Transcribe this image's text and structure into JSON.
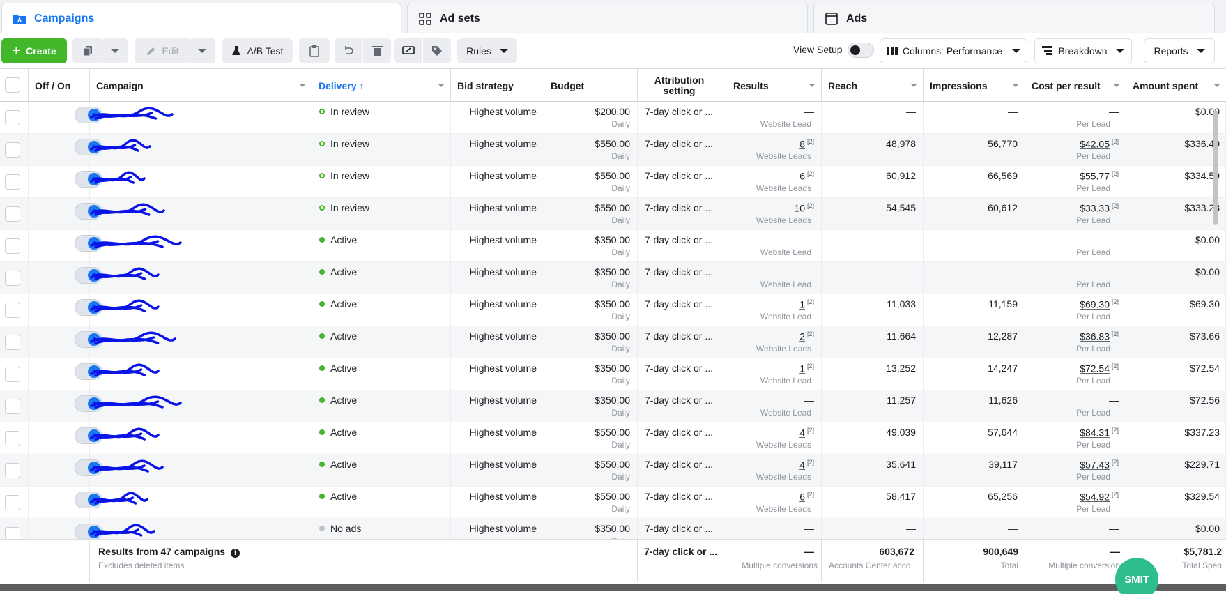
{
  "tabs": [
    {
      "label": "Campaigns",
      "icon": "folder-icon",
      "active": true
    },
    {
      "label": "Ad sets",
      "icon": "grid-icon",
      "active": false
    },
    {
      "label": "Ads",
      "icon": "ad-icon",
      "active": false
    }
  ],
  "toolbar": {
    "create_label": "Create",
    "edit_label": "Edit",
    "ab_test_label": "A/B Test",
    "rules_label": "Rules",
    "view_setup_label": "View Setup",
    "columns_label": "Columns: Performance",
    "breakdown_label": "Breakdown",
    "reports_label": "Reports"
  },
  "columns": {
    "off_on": "Off / On",
    "campaign": "Campaign",
    "delivery": "Delivery",
    "bid_strategy": "Bid strategy",
    "budget": "Budget",
    "attribution": "Attribution setting",
    "results": "Results",
    "reach": "Reach",
    "impressions": "Impressions",
    "cost_per_result": "Cost per result",
    "amount_spent": "Amount spent"
  },
  "rows": [
    {
      "delivery": "In review",
      "status": "review",
      "bid": "Highest volume",
      "budget": "$200.00",
      "budget_type": "Daily",
      "attribution": "7-day click or ...",
      "results": "—",
      "results_sub": "Website Lead",
      "reach": "—",
      "impressions": "—",
      "cpr": "—",
      "cpr_sub": "Per Lead",
      "spent": "$0.00"
    },
    {
      "delivery": "In review",
      "status": "review",
      "bid": "Highest volume",
      "budget": "$550.00",
      "budget_type": "Daily",
      "attribution": "7-day click or ...",
      "results": "8",
      "results_sub": "Website Leads",
      "reach": "48,978",
      "impressions": "56,770",
      "cpr": "$42.05",
      "cpr_sub": "Per Lead",
      "spent": "$336.40"
    },
    {
      "delivery": "In review",
      "status": "review",
      "bid": "Highest volume",
      "budget": "$550.00",
      "budget_type": "Daily",
      "attribution": "7-day click or ...",
      "results": "6",
      "results_sub": "Website Leads",
      "reach": "60,912",
      "impressions": "66,569",
      "cpr": "$55.77",
      "cpr_sub": "Per Lead",
      "spent": "$334.59"
    },
    {
      "delivery": "In review",
      "status": "review",
      "bid": "Highest volume",
      "budget": "$550.00",
      "budget_type": "Daily",
      "attribution": "7-day click or ...",
      "results": "10",
      "results_sub": "Website Leads",
      "reach": "54,545",
      "impressions": "60,612",
      "cpr": "$33.33",
      "cpr_sub": "Per Lead",
      "spent": "$333.28"
    },
    {
      "delivery": "Active",
      "status": "active",
      "bid": "Highest volume",
      "budget": "$350.00",
      "budget_type": "Daily",
      "attribution": "7-day click or ...",
      "results": "—",
      "results_sub": "Website Lead",
      "reach": "—",
      "impressions": "—",
      "cpr": "—",
      "cpr_sub": "Per Lead",
      "spent": "$0.00"
    },
    {
      "delivery": "Active",
      "status": "active",
      "bid": "Highest volume",
      "budget": "$350.00",
      "budget_type": "Daily",
      "attribution": "7-day click or ...",
      "results": "—",
      "results_sub": "Website Lead",
      "reach": "—",
      "impressions": "—",
      "cpr": "—",
      "cpr_sub": "Per Lead",
      "spent": "$0.00"
    },
    {
      "delivery": "Active",
      "status": "active",
      "bid": "Highest volume",
      "budget": "$350.00",
      "budget_type": "Daily",
      "attribution": "7-day click or ...",
      "results": "1",
      "results_sub": "Website Lead",
      "reach": "11,033",
      "impressions": "11,159",
      "cpr": "$69.30",
      "cpr_sub": "Per Lead",
      "spent": "$69.30"
    },
    {
      "delivery": "Active",
      "status": "active",
      "bid": "Highest volume",
      "budget": "$350.00",
      "budget_type": "Daily",
      "attribution": "7-day click or ...",
      "results": "2",
      "results_sub": "Website Leads",
      "reach": "11,664",
      "impressions": "12,287",
      "cpr": "$36.83",
      "cpr_sub": "Per Lead",
      "spent": "$73.66"
    },
    {
      "delivery": "Active",
      "status": "active",
      "bid": "Highest volume",
      "budget": "$350.00",
      "budget_type": "Daily",
      "attribution": "7-day click or ...",
      "results": "1",
      "results_sub": "Website Lead",
      "reach": "13,252",
      "impressions": "14,247",
      "cpr": "$72.54",
      "cpr_sub": "Per Lead",
      "spent": "$72.54"
    },
    {
      "delivery": "Active",
      "status": "active",
      "bid": "Highest volume",
      "budget": "$350.00",
      "budget_type": "Daily",
      "attribution": "7-day click or ...",
      "results": "—",
      "results_sub": "Website Lead",
      "reach": "11,257",
      "impressions": "11,626",
      "cpr": "—",
      "cpr_sub": "Per Lead",
      "spent": "$72.56"
    },
    {
      "delivery": "Active",
      "status": "active",
      "bid": "Highest volume",
      "budget": "$550.00",
      "budget_type": "Daily",
      "attribution": "7-day click or ...",
      "results": "4",
      "results_sub": "Website Leads",
      "reach": "49,039",
      "impressions": "57,644",
      "cpr": "$84.31",
      "cpr_sub": "Per Lead",
      "spent": "$337.23"
    },
    {
      "delivery": "Active",
      "status": "active",
      "bid": "Highest volume",
      "budget": "$550.00",
      "budget_type": "Daily",
      "attribution": "7-day click or ...",
      "results": "4",
      "results_sub": "Website Leads",
      "reach": "35,641",
      "impressions": "39,117",
      "cpr": "$57.43",
      "cpr_sub": "Per Lead",
      "spent": "$229.71"
    },
    {
      "delivery": "Active",
      "status": "active",
      "bid": "Highest volume",
      "budget": "$550.00",
      "budget_type": "Daily",
      "attribution": "7-day click or ...",
      "results": "6",
      "results_sub": "Website Leads",
      "reach": "58,417",
      "impressions": "65,256",
      "cpr": "$54.92",
      "cpr_sub": "Per Lead",
      "spent": "$329.54"
    },
    {
      "delivery": "No ads",
      "status": "noads",
      "bid": "Highest volume",
      "budget": "$350.00",
      "budget_type": "Daily",
      "attribution": "7-day click or ...",
      "results": "—",
      "results_sub": "",
      "reach": "—",
      "impressions": "—",
      "cpr": "—",
      "cpr_sub": "",
      "spent": "$0.00"
    }
  ],
  "footer": {
    "title": "Results from 47 campaigns",
    "subtitle": "Excludes deleted items",
    "attribution": "7-day click or ...",
    "results": "—",
    "results_sub": "Multiple conversions",
    "reach": "603,672",
    "reach_sub": "Accounts Center acco...",
    "impressions": "900,649",
    "impressions_sub": "Total",
    "cpr": "—",
    "cpr_sub": "Multiple conversions",
    "spent": "$5,781.2",
    "spent_sub": "Total Spen"
  },
  "badge": "SMIT",
  "colors": {
    "accent": "#1877f2",
    "create": "#42b72a",
    "scribble": "#0a14e6"
  }
}
